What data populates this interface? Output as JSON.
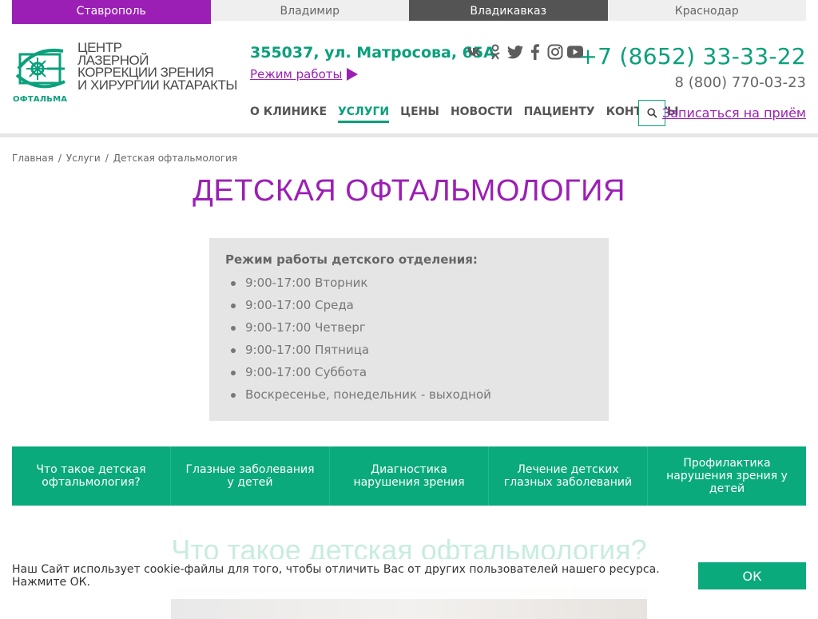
{
  "cities": [
    "Ставрополь",
    "Владимир",
    "Владикавказ",
    "Краснодар"
  ],
  "logo": {
    "lines": [
      "Центр",
      "лазерной",
      "коррекции зрения",
      "и хирургии катаракты"
    ],
    "caption": "ОФТАЛЬМА"
  },
  "contact": {
    "address": "355037, ул. Матросова, 65А",
    "hours_link": "Режим работы",
    "phone_main": "+7 (8652) 33-33-22",
    "phone_free": "8 (800) 770-03-23"
  },
  "socials": [
    "vk-icon",
    "odnoklassniki-icon",
    "twitter-icon",
    "facebook-icon",
    "instagram-icon",
    "youtube-icon"
  ],
  "nav": [
    "О клинике",
    "Услуги",
    "Цены",
    "Новости",
    "Пациенту",
    "Контакты"
  ],
  "nav_active": "Услуги",
  "appointment_link": "Записаться на приём",
  "breadcrumb": [
    "Главная",
    "Услуги",
    "Детская офтальмология"
  ],
  "page_title": "ДЕТСКАЯ ОФТАЛЬМОЛОГИЯ",
  "schedule": {
    "title": "Режим работы детского отделения:",
    "items": [
      "9:00-17:00 Вторник",
      "9:00-17:00 Среда",
      "9:00-17:00 Четверг",
      "9:00-17:00 Пятница",
      "9:00-17:00 Суббота",
      "Воскресенье, понедельник - выходной"
    ]
  },
  "tabs": [
    "Что такое детская офтальмология?",
    "Глазные заболевания у детей",
    "Диагностика нарушения зрения",
    "Лечение детских глазных заболеваний",
    "Профилактика нарушения зрения у детей"
  ],
  "section_title": "Что такое детская офтальмология?",
  "cookie": {
    "text": "Наш Сайт использует cookie-файлы для того, чтобы отличить Вас от других пользователей нашего ресурса. Нажмите ОК.",
    "button": "ОК"
  },
  "colors": {
    "brand_green": "#0aa07b",
    "brand_purple": "#9c1fb5",
    "dark_gray": "#545454"
  }
}
